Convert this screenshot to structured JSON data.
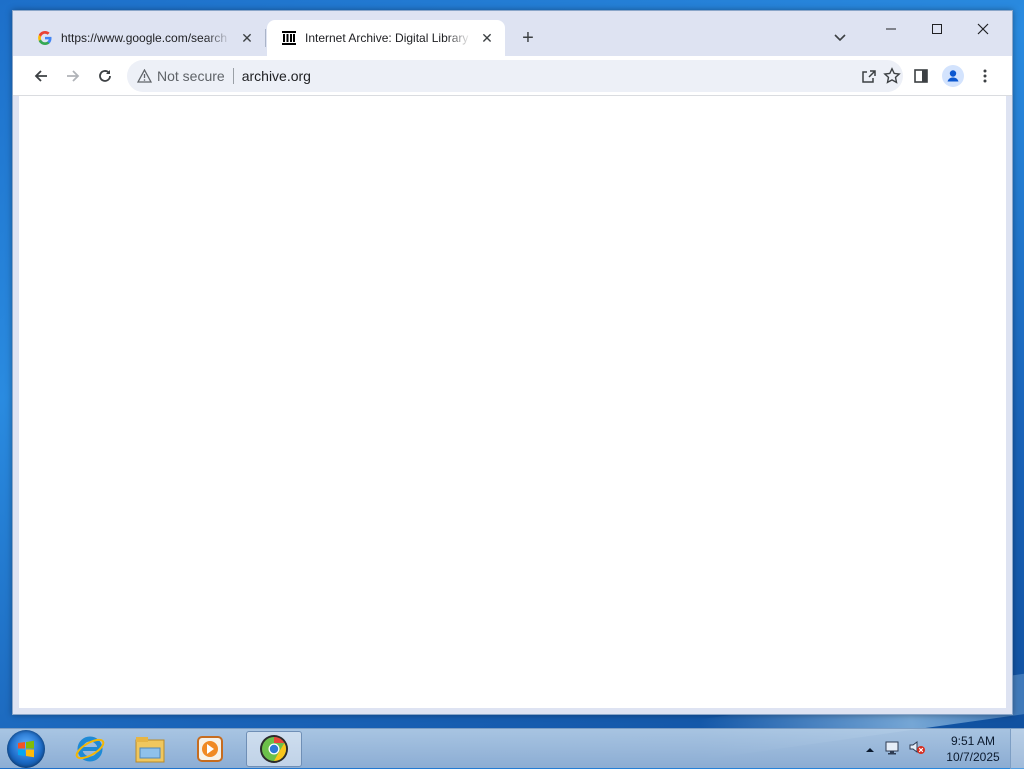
{
  "browser": {
    "tabs": [
      {
        "title": "https://www.google.com/search",
        "favicon": "google-g-icon",
        "active": false
      },
      {
        "title": "Internet Archive: Digital Library of Free",
        "favicon": "archive-building-icon",
        "active": true
      }
    ],
    "omnibox": {
      "security_label": "Not secure",
      "url": "archive.org"
    }
  },
  "taskbar": {
    "apps": [
      "windows-explorer",
      "internet-explorer",
      "file-explorer",
      "media-player",
      "chrome"
    ],
    "clock": {
      "time": "9:51 AM",
      "date": "10/7/2025"
    }
  },
  "colors": {
    "tabstrip": "#dee3f2",
    "omnibox_bg": "#edf0f7",
    "desktop": "#1d6fc9"
  }
}
